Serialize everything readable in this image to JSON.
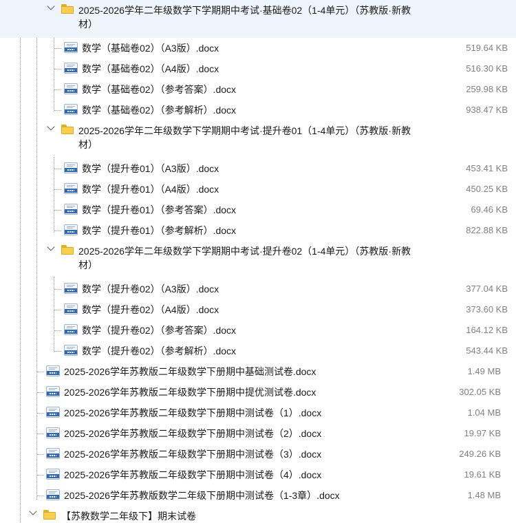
{
  "tree": {
    "folder_open_1": {
      "label_line1": "2025-2026学年二年级数学下学期期中考试·基础卷02（1-4单元）（苏教版·新教",
      "label_line2": "材）",
      "files": [
        {
          "name": "数学（基础卷02）（A3版）.docx",
          "size": "519.64 KB"
        },
        {
          "name": "数学（基础卷02）（A4版）.docx",
          "size": "516.30 KB"
        },
        {
          "name": "数学（基础卷02）（参考答案）.docx",
          "size": "259.98 KB"
        },
        {
          "name": "数学（基础卷02）（参考解析）.docx",
          "size": "938.47 KB"
        }
      ]
    },
    "folder_open_2": {
      "label_line1": "2025-2026学年二年级数学下学期期中考试·提升卷01（1-4单元）（苏教版·新教",
      "label_line2": "材）",
      "files": [
        {
          "name": "数学（提升卷01）（A3版）.docx",
          "size": "453.41 KB"
        },
        {
          "name": "数学（提升卷01）（A4版）.docx",
          "size": "450.25 KB"
        },
        {
          "name": "数学（提升卷01）（参考答案）.docx",
          "size": "69.46 KB"
        },
        {
          "name": "数学（提升卷01）（参考解析）.docx",
          "size": "822.88 KB"
        }
      ]
    },
    "folder_open_3": {
      "label_line1": "2025-2026学年二年级数学下学期期中考试·提升卷02（1-4单元）（苏教版·新教",
      "label_line2": "材）",
      "files": [
        {
          "name": "数学（提升卷02）（A3版）.docx",
          "size": "377.04 KB"
        },
        {
          "name": "数学（提升卷02）（A4版）.docx",
          "size": "373.60 KB"
        },
        {
          "name": "数学（提升卷02）（参考答案）.docx",
          "size": "164.12 KB"
        },
        {
          "name": "数学（提升卷02）（参考解析）.docx",
          "size": "543.44 KB"
        }
      ]
    },
    "sibling_files": [
      {
        "name": "2025-2026学年苏教版二年级数学下册期中基础测试卷.docx",
        "size": "1.49 MB"
      },
      {
        "name": "2025-2026学年苏教版二年级数学下册期中提优测试卷.docx",
        "size": "302.05 KB"
      },
      {
        "name": "2025-2026学年苏教版二年级数学下册期中测试卷（1）.docx",
        "size": "1.04 MB"
      },
      {
        "name": "2025-2026学年苏教版二年级数学下册期中测试卷（2）.docx",
        "size": "19.97 KB"
      },
      {
        "name": "2025-2026学年苏教版二年级数学下册期中测试卷（3）.docx",
        "size": "249.26 KB"
      },
      {
        "name": "2025-2026学年苏教版二年级数学下册期中测试卷（4）.docx",
        "size": "19.61 KB"
      },
      {
        "name": "2025-2026学年苏教版数学二年级下册期中测试卷（1-3章）.docx",
        "size": "1.48 MB"
      }
    ],
    "folder_bottom": {
      "label": "【苏教数学二年级下】期末试卷"
    }
  },
  "colors": {
    "folder": "#f7cf4d",
    "doc_band": "#2f69b7",
    "size_text": "#808080",
    "guide_line": "#9a9a9a"
  }
}
